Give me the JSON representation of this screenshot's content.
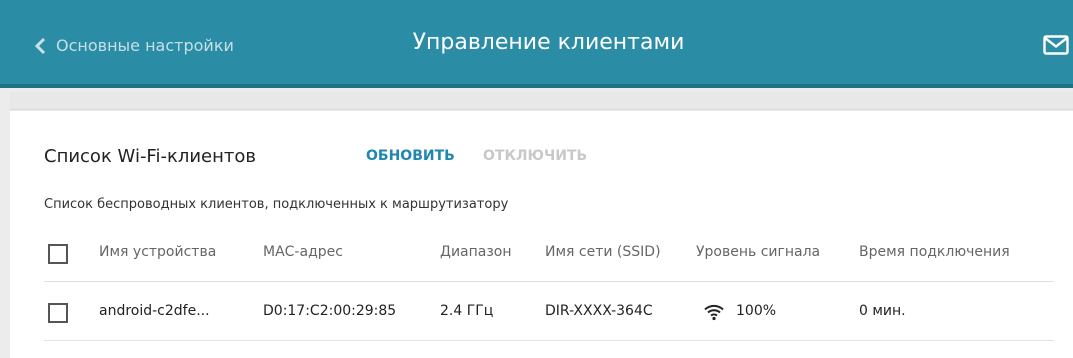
{
  "header": {
    "back_label": "Основные настройки",
    "title": "Управление клиентами",
    "bg_color": "#2b8da5"
  },
  "section": {
    "title": "Список Wi-Fi-клиентов",
    "refresh_label": "ОБНОВИТЬ",
    "disconnect_label": "ОТКЛЮЧИТЬ",
    "subtitle": "Список беспроводных клиентов, подключенных к маршрутизатору"
  },
  "table": {
    "columns": [
      "Имя устройства",
      "МАС-адрес",
      "Диапазон",
      "Имя сети (SSID)",
      "Уровень сигнала",
      "Время подключения"
    ],
    "rows": [
      {
        "device": "android-c2dfe...",
        "mac": "D0:17:C2:00:29:85",
        "band": "2.4 ГГц",
        "ssid": "DIR-XXXX-364C",
        "signal": "100%",
        "time": "0 мин."
      }
    ]
  },
  "icons": {
    "back": "chevron-left-icon",
    "mail": "mail-icon",
    "signal": "wifi-icon"
  },
  "colors": {
    "accent": "#1f87b0",
    "disabled": "#c8c8c8"
  }
}
